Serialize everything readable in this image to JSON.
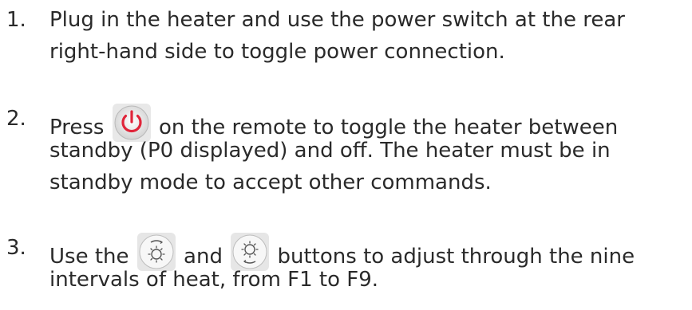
{
  "steps": [
    {
      "number": "1.",
      "lines": [
        "Plug in the heater and use the power switch at the rear",
        "right-hand side to toggle power connection."
      ]
    },
    {
      "number": "2.",
      "line1_before": "Press ",
      "line1_icon": "power-button-icon",
      "line1_after": " on the remote to toggle the heater between",
      "lines": [
        "standby (P0 displayed) and off. The heater must be in",
        "standby mode to accept other commands."
      ]
    },
    {
      "number": "3.",
      "line1_before": "Use the ",
      "line1_icon_a": "heat-up-button-icon",
      "line1_middle": " and ",
      "line1_icon_b": "heat-down-button-icon",
      "line1_after": " buttons to adjust through the nine",
      "lines": [
        "intervals of heat, from F1 to F9."
      ]
    }
  ],
  "colors": {
    "text": "#2a2a2a",
    "power_red": "#e0253a",
    "icon_bg": "#f2f2f2"
  }
}
